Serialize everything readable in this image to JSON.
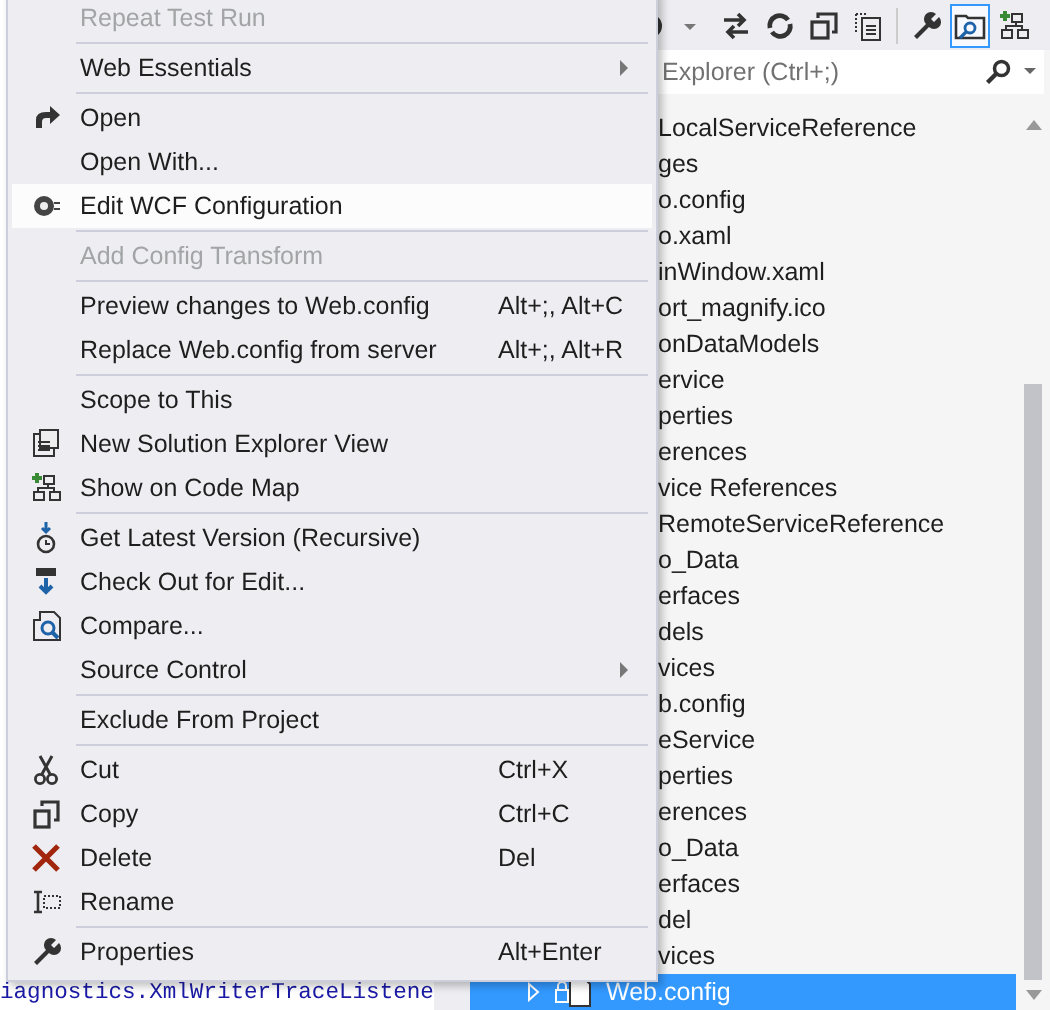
{
  "editor": {
    "code_line": "iagnostics.XmlWriterTraceListene"
  },
  "toolbar": {
    "buttons": [
      {
        "kind": "history"
      },
      {
        "kind": "dropdown"
      },
      {
        "kind": "sync",
        "selected": false
      },
      {
        "kind": "refresh",
        "selected": false
      },
      {
        "kind": "collapse",
        "selected": false
      },
      {
        "kind": "show-files",
        "selected": false
      },
      {
        "kind": "properties",
        "selected": false
      },
      {
        "kind": "preview",
        "selected": true
      },
      {
        "kind": "code-map",
        "selected": false
      }
    ]
  },
  "search": {
    "placeholder": "Explorer (Ctrl+;)"
  },
  "tree": {
    "rows": [
      {
        "label": "LocalServiceReference",
        "selected": false
      },
      {
        "label": "ges",
        "selected": false
      },
      {
        "label": "o.config",
        "selected": false
      },
      {
        "label": "o.xaml",
        "selected": false
      },
      {
        "label": "inWindow.xaml",
        "selected": false
      },
      {
        "label": "ort_magnify.ico",
        "selected": false
      },
      {
        "label": "onDataModels",
        "selected": false
      },
      {
        "label": "ervice",
        "selected": false
      },
      {
        "label": "perties",
        "selected": false
      },
      {
        "label": "erences",
        "selected": false
      },
      {
        "label": "vice References",
        "selected": false
      },
      {
        "label": "RemoteServiceReference",
        "selected": false
      },
      {
        "label": "o_Data",
        "selected": false
      },
      {
        "label": "erfaces",
        "selected": false
      },
      {
        "label": "dels",
        "selected": false
      },
      {
        "label": "vices",
        "selected": false
      },
      {
        "label": "b.config",
        "selected": false
      },
      {
        "label": "eService",
        "selected": false
      },
      {
        "label": "perties",
        "selected": false
      },
      {
        "label": "erences",
        "selected": false
      },
      {
        "label": "o_Data",
        "selected": false
      },
      {
        "label": "erfaces",
        "selected": false
      },
      {
        "label": "del",
        "selected": false
      },
      {
        "label": "vices",
        "selected": false
      }
    ],
    "last_row": {
      "label": "Web.config",
      "selected": true,
      "expanded": false
    }
  },
  "menu": {
    "groups": [
      [
        {
          "label": "Repeat Test Run",
          "disabled": true,
          "selected": false,
          "submenu": false
        }
      ],
      [
        {
          "label": "Web Essentials",
          "disabled": false,
          "selected": false,
          "submenu": true
        }
      ],
      [
        {
          "label": "Open",
          "disabled": false,
          "selected": false,
          "submenu": false
        },
        {
          "label": "Open With...",
          "disabled": false,
          "selected": false,
          "submenu": false
        },
        {
          "label": "Edit WCF Configuration",
          "disabled": false,
          "selected": true,
          "submenu": false
        }
      ],
      [
        {
          "label": "Add Config Transform",
          "disabled": true,
          "selected": false,
          "submenu": false
        }
      ],
      [
        {
          "label": "Preview changes to Web.config",
          "shortcut": "Alt+;, Alt+C",
          "disabled": false,
          "selected": false,
          "submenu": false
        },
        {
          "label": "Replace Web.config from server",
          "shortcut": "Alt+;, Alt+R",
          "disabled": false,
          "selected": false,
          "submenu": false
        }
      ],
      [
        {
          "label": "Scope to This",
          "disabled": false,
          "selected": false,
          "submenu": false
        },
        {
          "label": "New Solution Explorer View",
          "disabled": false,
          "selected": false,
          "submenu": false
        },
        {
          "label": "Show on Code Map",
          "disabled": false,
          "selected": false,
          "submenu": false
        }
      ],
      [
        {
          "label": "Get Latest Version (Recursive)",
          "disabled": false,
          "selected": false,
          "submenu": false
        },
        {
          "label": "Check Out for Edit...",
          "disabled": false,
          "selected": false,
          "submenu": false
        },
        {
          "label": "Compare...",
          "disabled": false,
          "selected": false,
          "submenu": false
        },
        {
          "label": "Source Control",
          "disabled": false,
          "selected": false,
          "submenu": true
        }
      ],
      [
        {
          "label": "Exclude From Project",
          "disabled": false,
          "selected": false,
          "submenu": false
        }
      ],
      [
        {
          "label": "Cut",
          "shortcut": "Ctrl+X",
          "disabled": false,
          "selected": false,
          "submenu": false
        },
        {
          "label": "Copy",
          "shortcut": "Ctrl+C",
          "disabled": false,
          "selected": false,
          "submenu": false
        },
        {
          "label": "Delete",
          "shortcut": "Del",
          "disabled": false,
          "selected": false,
          "submenu": false
        },
        {
          "label": "Rename",
          "disabled": false,
          "selected": false,
          "submenu": false
        }
      ],
      [
        {
          "label": "Properties",
          "shortcut": "Alt+Enter",
          "disabled": false,
          "selected": false,
          "submenu": false
        }
      ]
    ]
  }
}
